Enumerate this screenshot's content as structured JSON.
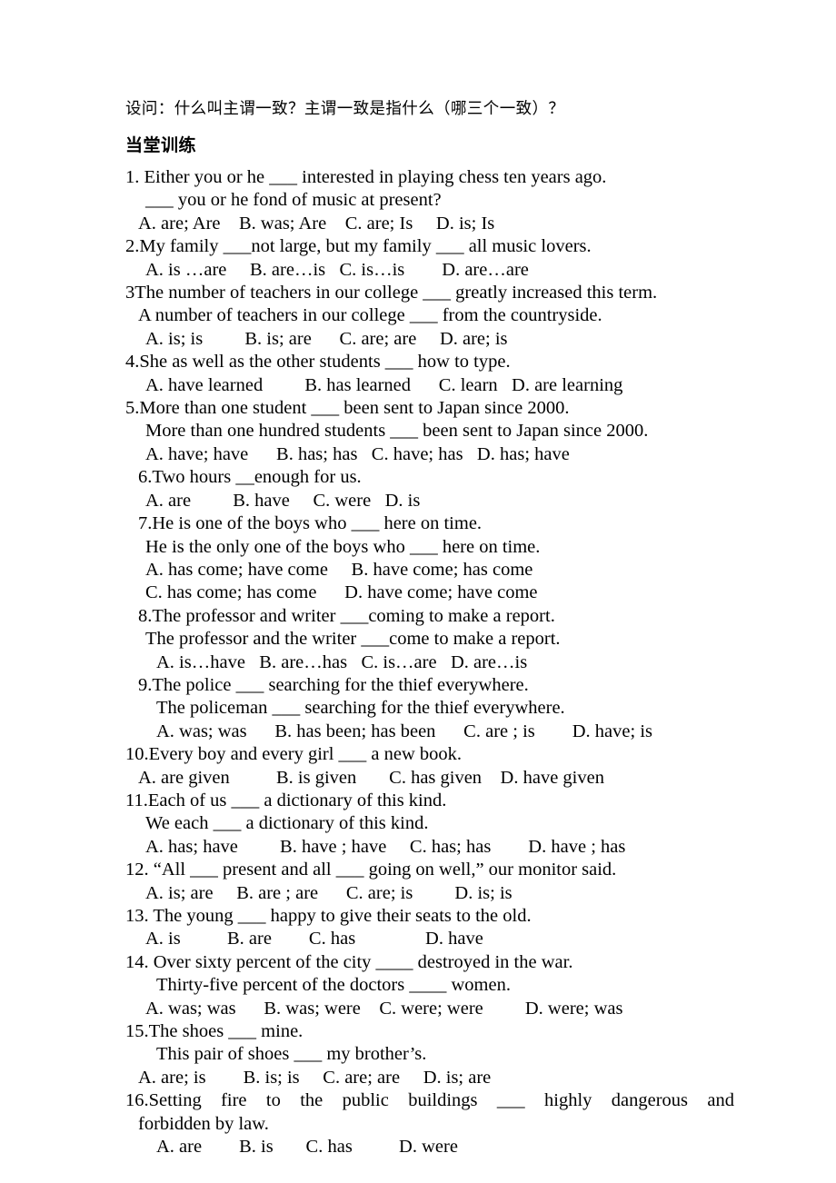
{
  "document": {
    "prompt_line": "设问：什么叫主谓一致？主谓一致是指什么（哪三个一致）？",
    "section_heading": "当堂训练",
    "questions": [
      {
        "stem": "1. Either you or he ___ interested in playing chess ten years ago.",
        "sub": "___ you or he fond of music at present?",
        "options": "A. are; Are    B. was; Are    C. are; Is     D. is; Is"
      },
      {
        "stem": "2.My family ___not large, but my family ___ all music lovers.",
        "options": "A. is …are     B. are…is   C. is…is        D. are…are"
      },
      {
        "stem": "3The number of teachers in our college ___ greatly increased this term.",
        "sub": "A number of teachers in our college ___ from the countryside.",
        "options": "A. is; is         B. is; are      C. are; are     D. are; is"
      },
      {
        "stem": "4.She as well as the other students ___ how to type.",
        "options": "A. have learned         B. has learned      C. learn   D. are learning"
      },
      {
        "stem": "5.More than one student ___ been sent to Japan since 2000.",
        "sub": "More than one hundred students ___ been sent to Japan since 2000.",
        "options": "A. have; have      B. has; has   C. have; has   D. has; have"
      },
      {
        "stem": "6.Two hours __enough for us.",
        "options": "A. are         B. have     C. were   D. is"
      },
      {
        "stem": "7.He is one of the boys who ___ here on time.",
        "sub": "He is the only one of the boys who ___ here on time.",
        "options": "A. has come; have come     B. have come; has come",
        "options2": "C. has come; has come      D. have come; have come"
      },
      {
        "stem": "8.The professor and writer ___coming to make a report.",
        "sub": "The professor and the writer ___come to make a report.",
        "options": "A. is…have   B. are…has   C. is…are   D. are…is"
      },
      {
        "stem": "9.The police ___ searching for the thief everywhere.",
        "sub": "The policeman ___ searching for the thief everywhere.",
        "options": "A. was; was      B. has been; has been      C. are ; is        D. have; is"
      },
      {
        "stem": "10.Every boy and every girl ___ a new book.",
        "options": "A. are given          B. is given       C. has given    D. have given"
      },
      {
        "stem": "11.Each of us ___ a dictionary of this kind.",
        "sub": "We each ___ a dictionary of this kind.",
        "options": "A. has; have         B. have ; have     C. has; has        D. have ; has"
      },
      {
        "stem": "12. “All ___ present and all ___ going on well,” our monitor said.",
        "options": "A. is; are     B. are ; are      C. are; is         D. is; is"
      },
      {
        "stem": "13. The young ___ happy to give their seats to the old.",
        "options": "A. is          B. are        C. has               D. have"
      },
      {
        "stem": "14. Over sixty percent of the city ____ destroyed in the war.",
        "sub": "Thirty-five percent of the doctors ____ women.",
        "options": "A. was; was      B. was; were    C. were; were         D. were; was"
      },
      {
        "stem": "15.The shoes ___ mine.",
        "sub": "This pair of shoes ___ my brother’s.",
        "options": "A. are; is        B. is; is     C. are; are     D. is; are"
      },
      {
        "stem": "16.Setting fire to the public buildings ___ highly dangerous and",
        "sub": "forbidden by law.",
        "options": "A. are        B. is       C. has          D. were"
      }
    ]
  }
}
